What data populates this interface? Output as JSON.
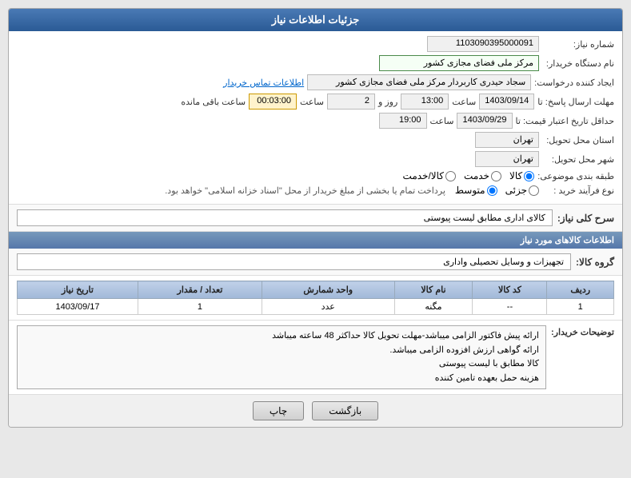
{
  "header": {
    "title": "جزئیات اطلاعات نیاز"
  },
  "fields": {
    "shomareNiaz_label": "شماره نیاز:",
    "shomareNiaz_value": "1103090395000091",
    "namDastgah_label": "نام دستگاه خریدار:",
    "namDastgah_value": "مرکز ملی فضای مجازی کشور",
    "ijadKonande_label": "ایجاد کننده درخواست:",
    "ijadKonande_value": "سجاد حیدری کاربردار مرکز ملی فضای مجازی کشور",
    "ettelaat_link": "اطلاعات تماس خریدار",
    "mohlatErsal_label": "مهلت ارسال پاسخ: تا",
    "mohlatErsal_date": "1403/09/14",
    "mohlatErsal_time": "13:00",
    "mohlatErsal_ruz": "روز و",
    "mohlatErsal_ruz_val": "2",
    "mohlatErsal_saet_val": "00:03:00",
    "mohlatErsal_mande": "ساعت باقی مانده",
    "hadat_label": "حداقل تاریخ اعتبار قیمت: تا",
    "hadat_date": "1403/09/29",
    "hadat_time": "19:00",
    "ostan_label": "استان محل تحویل:",
    "ostan_value": "تهران",
    "shahr_label": "شهر محل تحویل:",
    "shahr_value": "تهران",
    "tabaghe_label": "طبقه بندی موضوعی:",
    "tabaghe_kala": "کالا",
    "tabaghe_khadamat": "خدمت",
    "tabaghe_kala_khadamat": "کالا/خدمت",
    "noeFarayand_label": "نوع فرآیند خرید :",
    "noeFarayand_jozi": "جزئی",
    "noeFarayand_motavaset": "متوسط",
    "noeFarayand_text": "پرداخت تمام یا بخشی از مبلغ خریدار از محل \"اسناد خزانه اسلامی\" خواهد بود.",
    "sarh_label": "سرح کلی نیاز:",
    "sarh_value": "کالای اداری مطابق لیست پیوستی",
    "kalaInfo_title": "اطلاعات کالاهای مورد نیاز",
    "groheKala_label": "گروه کالا:",
    "groheKala_value": "تجهیزات و وسایل تحصیلی واداری",
    "table": {
      "headers": [
        "ردیف",
        "کد کالا",
        "نام کالا",
        "واحد شمارش",
        "تعداد / مقدار",
        "تاریخ نیاز"
      ],
      "rows": [
        {
          "radif": "1",
          "kod": "--",
          "nam": "مگنه",
          "vahed": "عدد",
          "tedad": "1",
          "tarikh": "1403/09/17"
        }
      ]
    },
    "notes_label": "توضیحات خریدار:",
    "notes_lines": [
      "ارائه پیش فاکتور الزامی میباشد-مهلت تحویل کالا حداکثر 48 ساعته میباشد",
      "ارائه گواهی ارزش افزوده الزامی میباشد.",
      "کالا مطابق با لیست پیوستی",
      "هزینه حمل بعهده تامین کننده"
    ]
  },
  "buttons": {
    "chap": "چاپ",
    "bazgasht": "بازگشت"
  }
}
